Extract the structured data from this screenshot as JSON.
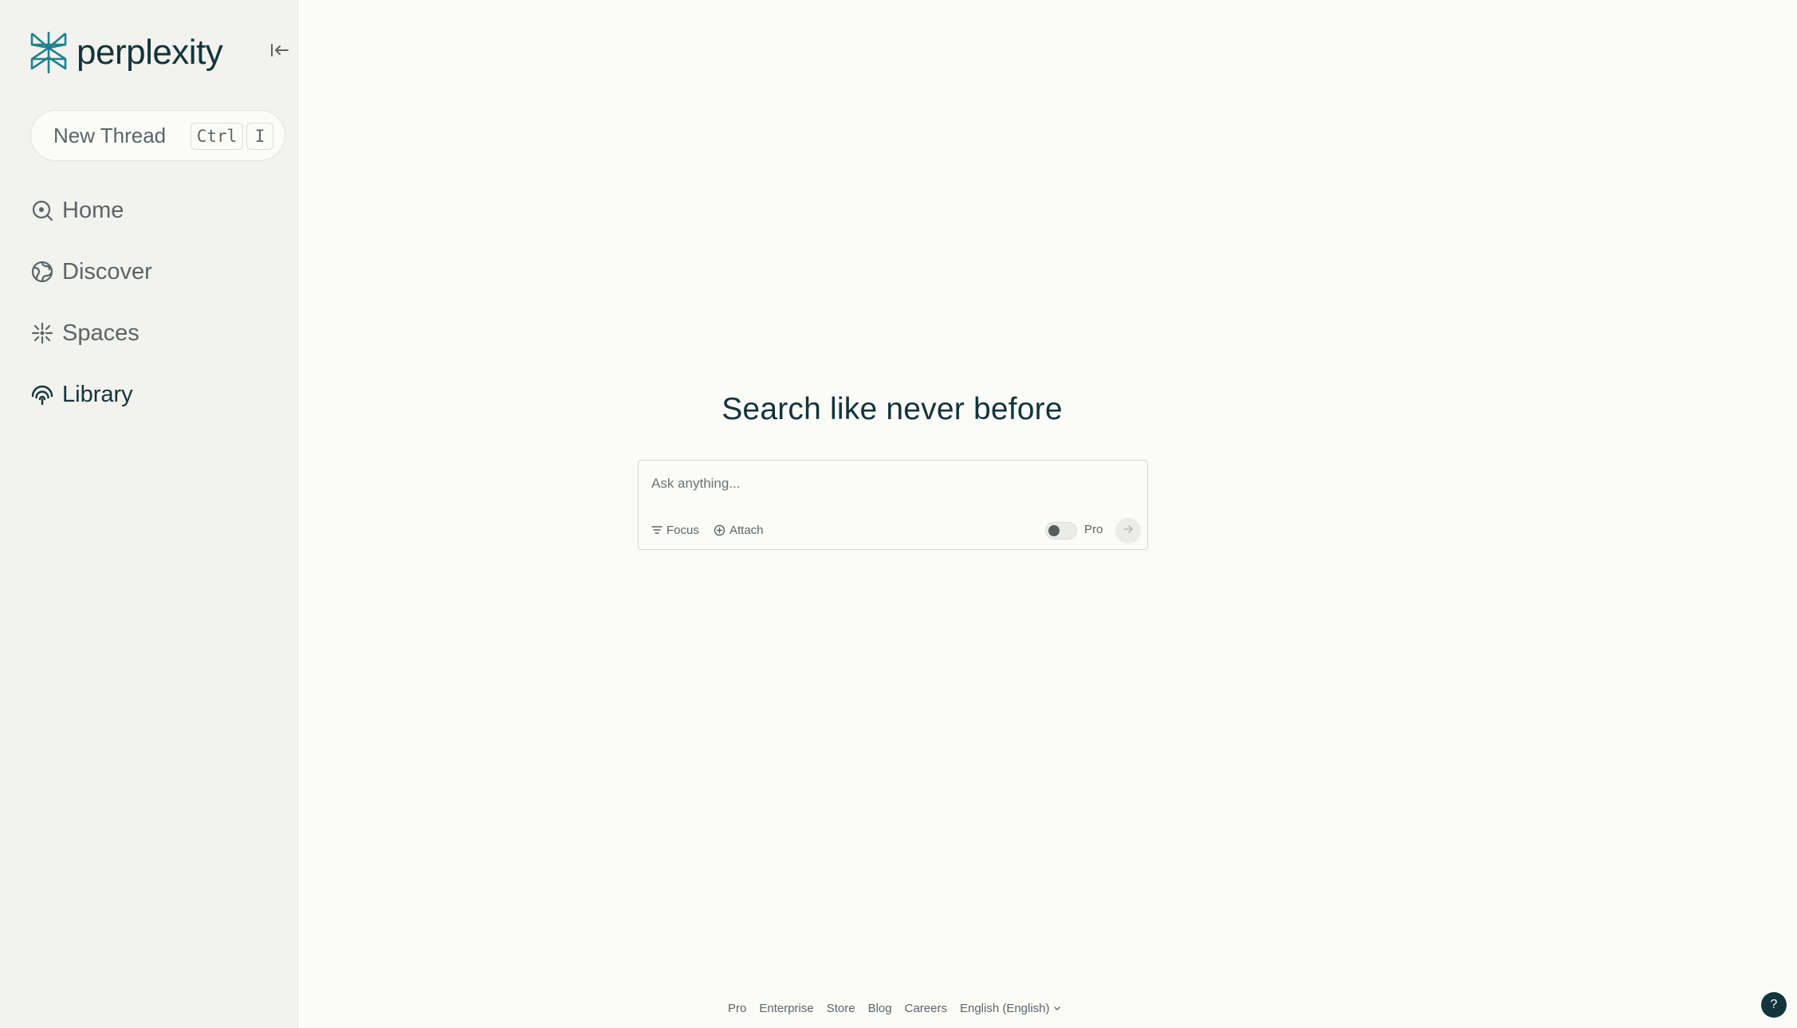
{
  "brand": {
    "name": "perplexity",
    "color": "#20808d",
    "text_color": "#13343b"
  },
  "sidebar": {
    "new_thread": {
      "label": "New Thread",
      "shortcut_keys": [
        "Ctrl",
        "I"
      ]
    },
    "items": [
      {
        "label": "Home",
        "icon": "home-search-icon",
        "active": false
      },
      {
        "label": "Discover",
        "icon": "globe-icon",
        "active": false
      },
      {
        "label": "Spaces",
        "icon": "sparkle-icon",
        "active": false
      },
      {
        "label": "Library",
        "icon": "library-icon",
        "active": true
      }
    ]
  },
  "main": {
    "headline": "Search like never before",
    "search": {
      "placeholder": "Ask anything...",
      "value": "",
      "focus_label": "Focus",
      "attach_label": "Attach",
      "pro_label": "Pro",
      "pro_enabled": false
    }
  },
  "footer": {
    "links": [
      "Pro",
      "Enterprise",
      "Store",
      "Blog",
      "Careers"
    ],
    "language": "English (English)"
  },
  "help": {
    "label": "?"
  }
}
